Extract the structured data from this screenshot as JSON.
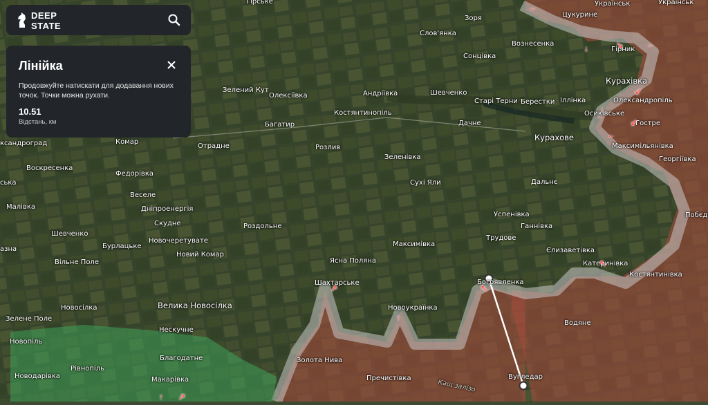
{
  "app": {
    "logo_line1": "DEEP",
    "logo_line2": "STATE",
    "search_icon": "search-icon"
  },
  "ruler": {
    "title": "Лінійка",
    "hint": "Продовжуйте натискати для додавання нових точок. Точки можна рухати.",
    "distance": "10.51",
    "unit_label": "Відстань, км",
    "close_icon": "close-icon"
  },
  "colors": {
    "occupied": "#a04a3c",
    "liberated": "#3ea15a",
    "contested": "#c8c8c8",
    "panel": "#22262b",
    "attack_arrow": "#ff4d4d"
  },
  "places": [
    {
      "name": "Зоря"
    },
    {
      "name": "Українськ"
    },
    {
      "name": "Українськ"
    },
    {
      "name": "Цукурине"
    },
    {
      "name": "Слов'янка"
    },
    {
      "name": "Вознесенка"
    },
    {
      "name": "Гірник"
    },
    {
      "name": "Сонцівка"
    },
    {
      "name": "Курахівка"
    },
    {
      "name": "Зелений Кут"
    },
    {
      "name": "Олексіївка"
    },
    {
      "name": "Андріївка"
    },
    {
      "name": "Шевченко"
    },
    {
      "name": "Старі Терни"
    },
    {
      "name": "Берестки"
    },
    {
      "name": "Іллінка"
    },
    {
      "name": "Олександропіль"
    },
    {
      "name": "Осиківське"
    },
    {
      "name": "Гострe"
    },
    {
      "name": "Костянтинопіль"
    },
    {
      "name": "Багатир"
    },
    {
      "name": "Дачне"
    },
    {
      "name": "Курахове"
    },
    {
      "name": "Максимільянівка"
    },
    {
      "name": "ксандроград"
    },
    {
      "name": "Комар"
    },
    {
      "name": "Отрадне"
    },
    {
      "name": "Розлив"
    },
    {
      "name": "Зеленівка"
    },
    {
      "name": "Георгіївка"
    },
    {
      "name": "Воскресенка"
    },
    {
      "name": "Федорівка"
    },
    {
      "name": "Сухі Яли"
    },
    {
      "name": "Дальнє"
    },
    {
      "name": "ська"
    },
    {
      "name": "Веселе"
    },
    {
      "name": "Малівка"
    },
    {
      "name": "Дніпроенергія"
    },
    {
      "name": "Успенівка"
    },
    {
      "name": "Побєда"
    },
    {
      "name": "Скудне"
    },
    {
      "name": "Роздольне"
    },
    {
      "name": "Ганнівка"
    },
    {
      "name": "Шевченко"
    },
    {
      "name": "Бурлацьке"
    },
    {
      "name": "Новочеретувате"
    },
    {
      "name": "Трудове"
    },
    {
      "name": "Максимівка"
    },
    {
      "name": "Єлизаветівка"
    },
    {
      "name": "азна"
    },
    {
      "name": "Новий Комар"
    },
    {
      "name": "Вільне Поле"
    },
    {
      "name": "Ясна Поляна"
    },
    {
      "name": "Катеринівка"
    },
    {
      "name": "Костянтинівка"
    },
    {
      "name": "Шахтарське"
    },
    {
      "name": "Богоявленка"
    },
    {
      "name": "Новосілка"
    },
    {
      "name": "Велика Новосілка"
    },
    {
      "name": "Новоукраїнка"
    },
    {
      "name": "Зелене Поле"
    },
    {
      "name": "Водяне"
    },
    {
      "name": "Нескучне"
    },
    {
      "name": "Новопіль"
    },
    {
      "name": "Благодатне"
    },
    {
      "name": "Золота Нива"
    },
    {
      "name": "Рівнопіль"
    },
    {
      "name": "Пречистівка"
    },
    {
      "name": "Вугледар"
    },
    {
      "name": "Новодарівка"
    },
    {
      "name": "Макарівка"
    },
    {
      "name": "Гірське"
    }
  ],
  "road_label": "Кащ\nзалізо"
}
